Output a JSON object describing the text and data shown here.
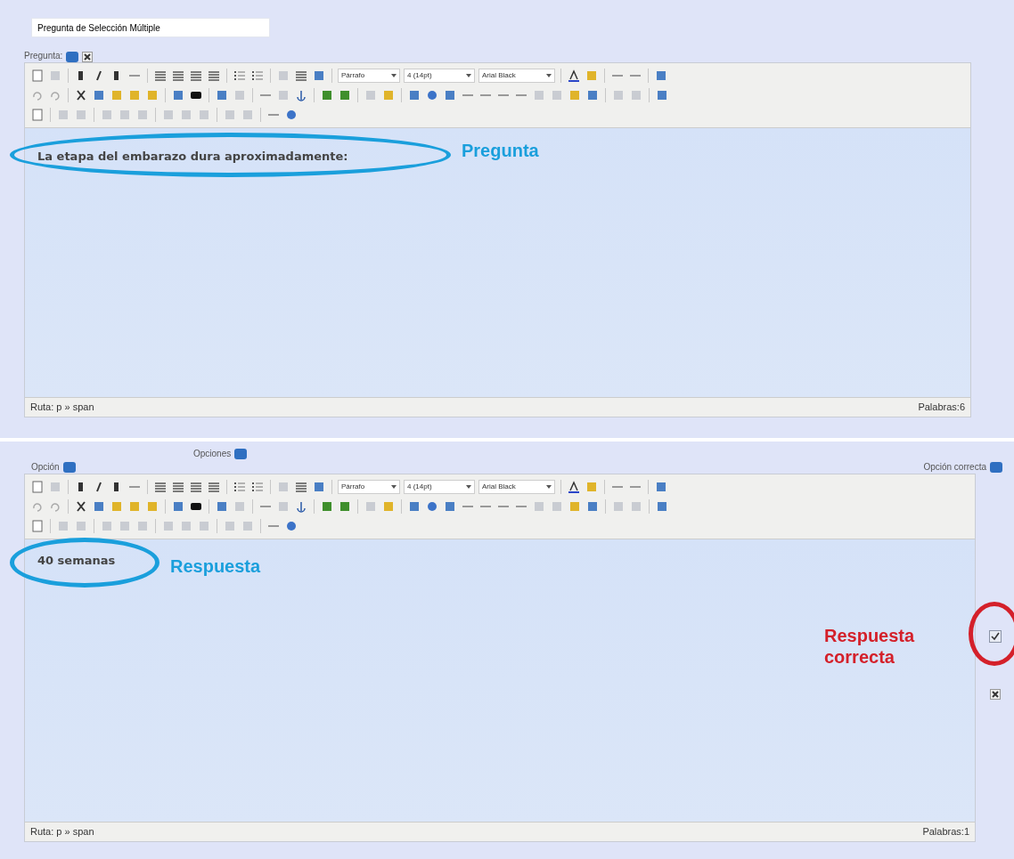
{
  "title_field": {
    "value": "Pregunta de Selección Múltiple"
  },
  "question": {
    "label": "Pregunta:",
    "editor": {
      "format_select": "Párrafo",
      "size_select": "4 (14pt)",
      "font_select": "Arial Black",
      "content": "La etapa del embarazo dura aproximadamente:",
      "path": "Ruta: p » span",
      "word_count": "Palabras:6"
    },
    "annotation": {
      "text": "Pregunta",
      "color": "#1a9fdc"
    }
  },
  "options": {
    "heading": "Opciones",
    "option_label": "Opción",
    "correct_label": "Opción correcta",
    "items": [
      {
        "editor": {
          "format_select": "Párrafo",
          "size_select": "4 (14pt)",
          "font_select": "Arial Black",
          "content": "40 semanas",
          "path": "Ruta: p » span",
          "word_count": "Palabras:1"
        },
        "annotation": {
          "text": "Respuesta",
          "color": "#1a9fdc"
        },
        "correct": true,
        "correct_annotation": {
          "text": "Respuesta correcta",
          "color": "#d4202a"
        }
      }
    ]
  }
}
